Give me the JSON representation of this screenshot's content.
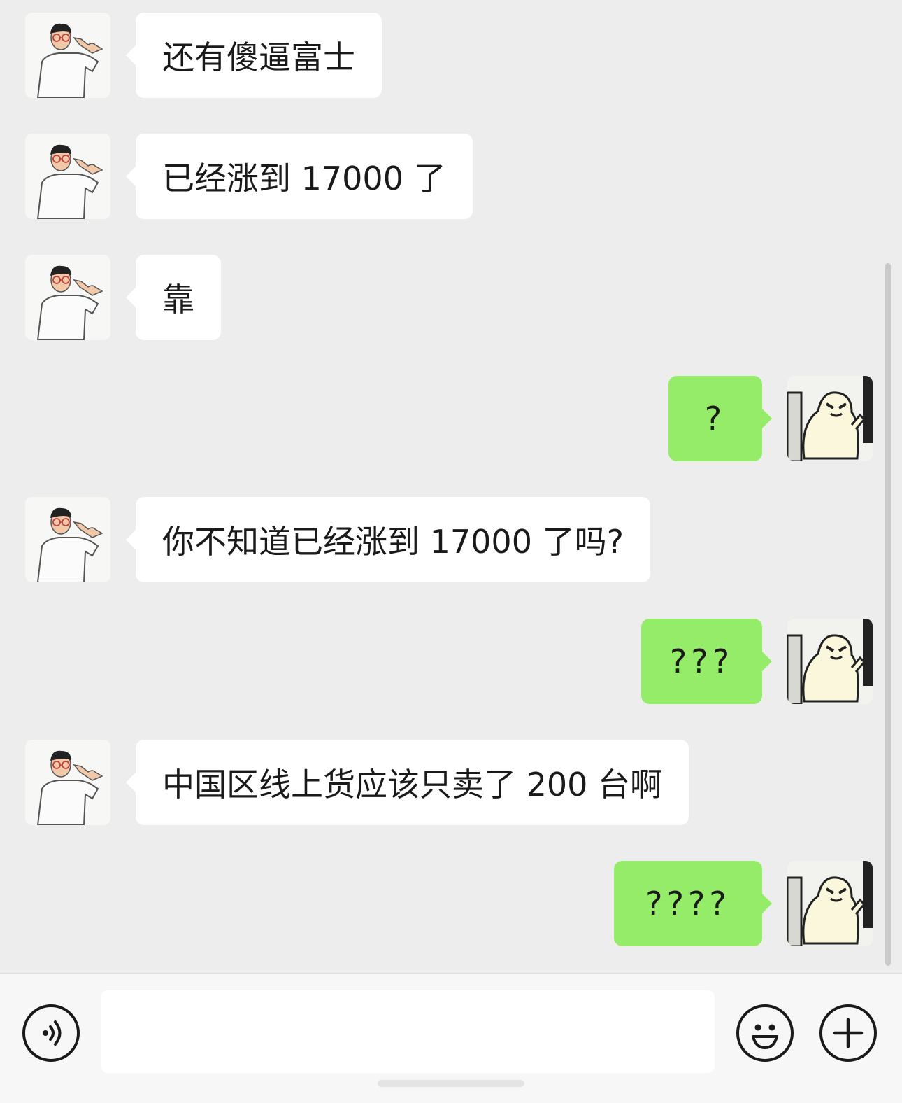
{
  "messages": [
    {
      "side": "in",
      "text": "还有傻逼富士"
    },
    {
      "side": "in",
      "text": "已经涨到 17000 了"
    },
    {
      "side": "in",
      "text": "靠"
    },
    {
      "side": "out",
      "text": "?"
    },
    {
      "side": "in",
      "text": "你不知道已经涨到 17000 了吗?"
    },
    {
      "side": "out",
      "text": "???"
    },
    {
      "side": "in",
      "text": "中国区线上货应该只卖了 200 台啊"
    },
    {
      "side": "out",
      "text": "????"
    }
  ],
  "input_bar": {
    "voice_icon": "voice-icon",
    "emoji_icon": "emoji-icon",
    "plus_icon": "plus-icon",
    "message_value": ""
  },
  "colors": {
    "background": "#ededed",
    "incoming_bubble": "#ffffff",
    "outgoing_bubble": "#95ec69"
  }
}
